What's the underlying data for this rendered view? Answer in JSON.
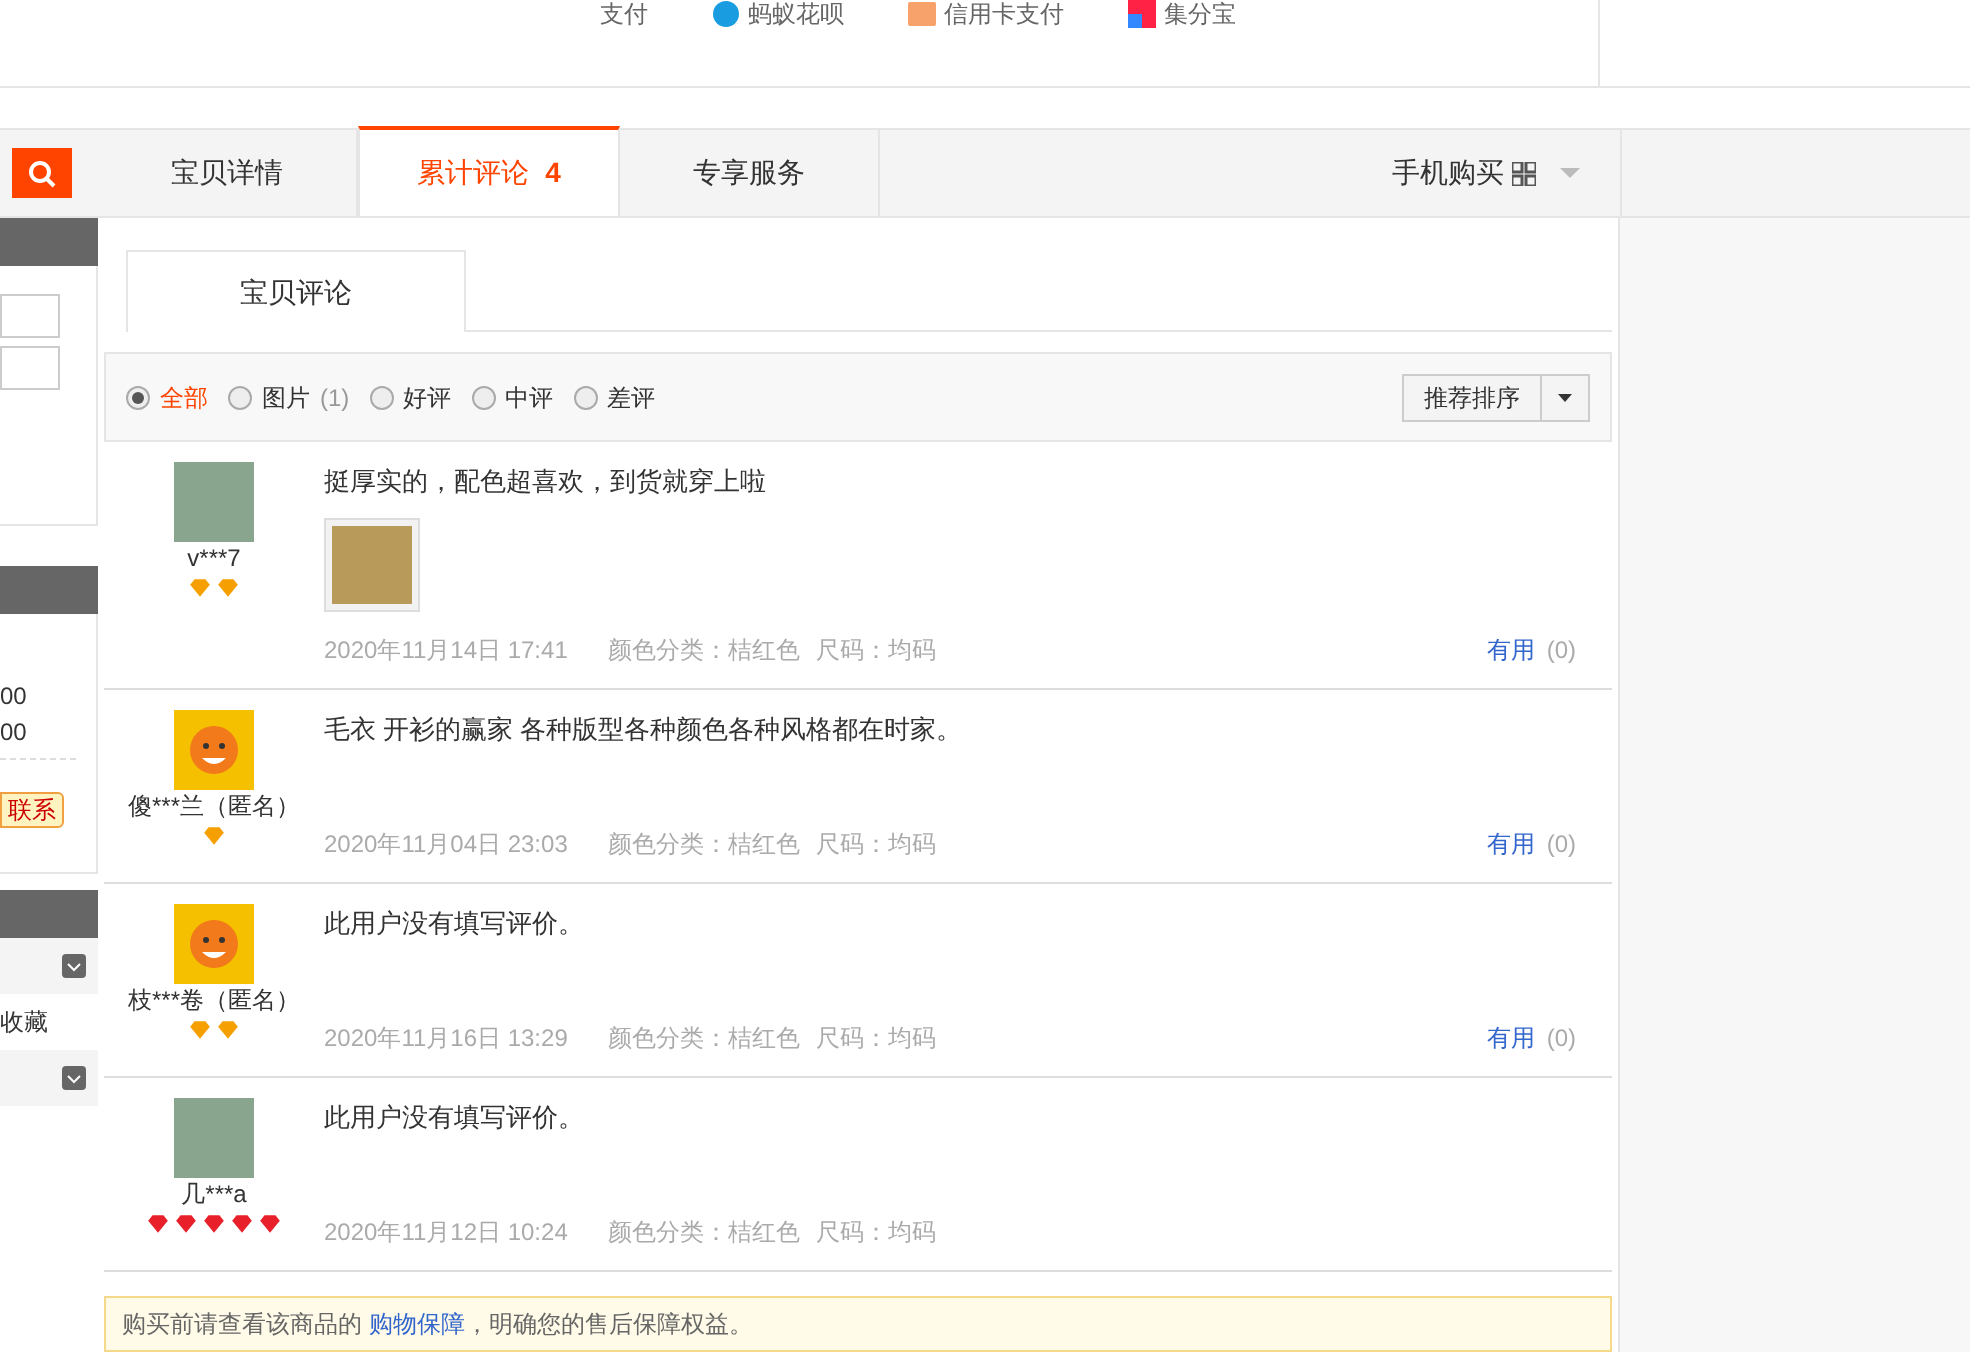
{
  "payment_bar": {
    "label": "支付",
    "methods": [
      {
        "kind": "huabei",
        "label": "蚂蚁花呗"
      },
      {
        "kind": "card",
        "label": "信用卡支付"
      },
      {
        "kind": "jifenbao",
        "label": "集分宝"
      }
    ]
  },
  "side": {
    "values": [
      "00",
      "00"
    ],
    "contact_button": "联系",
    "collect_link": "收藏"
  },
  "tabs": [
    {
      "label": "宝贝详情",
      "selected": false
    },
    {
      "label": "累计评论",
      "count": "4",
      "selected": true
    },
    {
      "label": "专享服务",
      "selected": false
    }
  ],
  "mobile_buy": "手机购买",
  "review_tab": "宝贝评论",
  "filters": [
    {
      "label": "全部",
      "selected": true
    },
    {
      "label": "图片",
      "count": "(1)",
      "selected": false
    },
    {
      "label": "好评",
      "selected": false
    },
    {
      "label": "中评",
      "selected": false
    },
    {
      "label": "差评",
      "selected": false
    }
  ],
  "sort_button": "推荐排序",
  "reviews": [
    {
      "kind": "photo",
      "user": "v***7",
      "rank_icons": [
        {
          "color": "#f5a000"
        },
        {
          "color": "#f5a000"
        }
      ],
      "text": "挺厚实的，配色超喜欢，到货就穿上啦",
      "has_photo": true,
      "date": "2020年11月14日 17:41",
      "color_spec": "颜色分类：桔红色",
      "size_spec": "尺码：均码",
      "useful": "有用",
      "useful_count": "(0)"
    },
    {
      "kind": "mascot",
      "user": "傻***兰（匿名）",
      "rank_icons": [
        {
          "color": "#f5a000"
        }
      ],
      "text": "毛衣 开衫的赢家 各种版型各种颜色各种风格都在时家。",
      "has_photo": false,
      "date": "2020年11月04日 23:03",
      "color_spec": "颜色分类：桔红色",
      "size_spec": "尺码：均码",
      "useful": "有用",
      "useful_count": "(0)"
    },
    {
      "kind": "mascot",
      "user": "枝***卷（匿名）",
      "rank_icons": [
        {
          "color": "#f5a000"
        },
        {
          "color": "#f5a000"
        }
      ],
      "text": "此用户没有填写评价。",
      "has_photo": false,
      "date": "2020年11月16日 13:29",
      "color_spec": "颜色分类：桔红色",
      "size_spec": "尺码：均码",
      "useful": "有用",
      "useful_count": "(0)"
    },
    {
      "kind": "photo",
      "user": "几***a",
      "rank_icons": [
        {
          "color": "#e8202a"
        },
        {
          "color": "#e8202a"
        },
        {
          "color": "#e8202a"
        },
        {
          "color": "#e8202a"
        },
        {
          "color": "#e8202a"
        }
      ],
      "text": "此用户没有填写评价。",
      "has_photo": false,
      "date": "2020年11月12日 10:24",
      "color_spec": "颜色分类：桔红色",
      "size_spec": "尺码：均码"
    }
  ],
  "notice": {
    "before": "购买前请查看该商品的 ",
    "link": "购物保障",
    "after": "，明确您的售后保障权益。"
  }
}
